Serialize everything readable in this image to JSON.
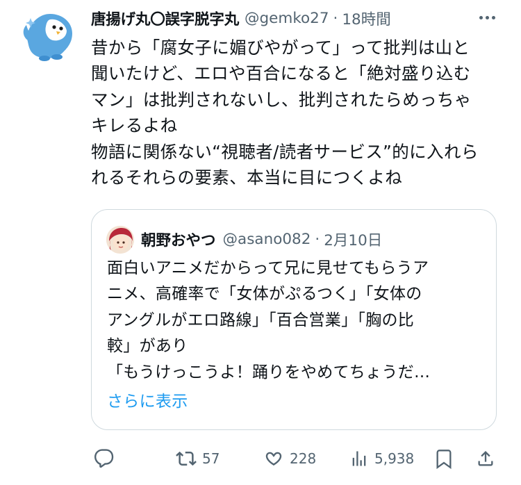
{
  "tweet": {
    "display_name": "唐揚げ丸〇誤字脱字丸",
    "handle": "@gemko27",
    "separator": "·",
    "time": "18時間",
    "body_lines": [
      "昔から「腐女子に媚びやがって」って批判は山と",
      "聞いたけど、エロや百合になると「絶対盛り込む",
      "マン」は批判されないし、批判されたらめっちゃ",
      "キレるよね",
      "物語に関係ない“視聴者/読者サービス”的に入れら",
      "れるそれらの要素、本当に目につくよね"
    ]
  },
  "quote": {
    "display_name": "朝野おやつ",
    "handle": "@asano082",
    "separator": "·",
    "date": "2月10日",
    "body_lines": [
      "面白いアニメだからって兄に見せてもらうア",
      "ニメ、高確率で「女体がぷるつく」「女体の",
      "アングルがエロ路線」「百合営業」「胸の比",
      "較」があり",
      "「もうけっこうよ！踊りをやめてちょうだ…"
    ],
    "show_more": "さらに表示"
  },
  "actions": {
    "reply_icon": "reply-icon",
    "retweet_icon": "retweet-icon",
    "retweet_count": "57",
    "like_icon": "heart-icon",
    "like_count": "228",
    "views_icon": "views-icon",
    "views_count": "5,938",
    "bookmark_icon": "bookmark-icon",
    "share_icon": "share-icon"
  },
  "colors": {
    "text_primary": "#0f1419",
    "text_secondary": "#536471",
    "link": "#1d9bf0",
    "border": "#cfd9de",
    "avatar_blue": "#5aa7e0"
  }
}
